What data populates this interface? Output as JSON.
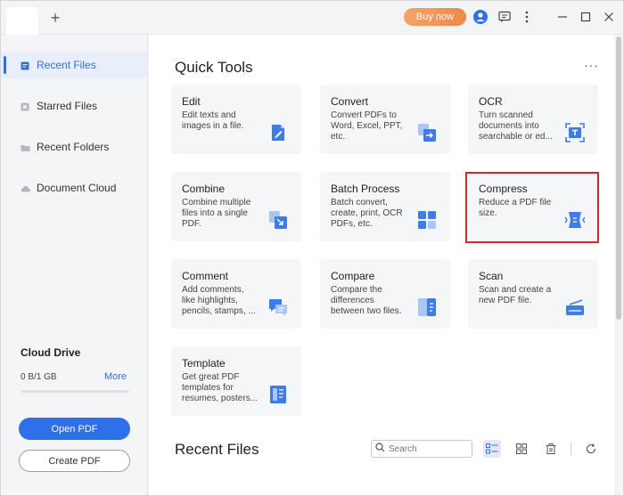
{
  "titlebar": {
    "add_tab_label": "+",
    "buy_now_label": "Buy now",
    "icons": [
      "account-icon",
      "message-icon",
      "more-vertical-icon",
      "minimize-icon",
      "maximize-icon",
      "close-icon"
    ]
  },
  "sidebar": {
    "items": [
      {
        "label": "Recent Files",
        "icon": "recent-files-icon",
        "active": true
      },
      {
        "label": "Starred Files",
        "icon": "star-icon",
        "active": false
      },
      {
        "label": "Recent Folders",
        "icon": "folder-icon",
        "active": false
      },
      {
        "label": "Document Cloud",
        "icon": "cloud-icon",
        "active": false
      }
    ],
    "cloud_drive": {
      "title": "Cloud Drive",
      "storage": "0 B/1 GB",
      "more_label": "More",
      "usage_fraction": 0
    },
    "open_pdf_label": "Open PDF",
    "create_pdf_label": "Create PDF"
  },
  "main": {
    "quick_tools_title": "Quick Tools",
    "more_label": "···",
    "tools": [
      {
        "title": "Edit",
        "desc": "Edit texts and\nimages in a file.",
        "icon": "edit-icon"
      },
      {
        "title": "Convert",
        "desc": "Convert PDFs to\nWord, Excel, PPT,\netc.",
        "icon": "convert-icon"
      },
      {
        "title": "OCR",
        "desc": "Turn scanned\ndocuments into\nsearchable or ed...",
        "icon": "ocr-icon"
      },
      {
        "title": "Combine",
        "desc": "Combine multiple\nfiles into a single\nPDF.",
        "icon": "combine-icon"
      },
      {
        "title": "Batch Process",
        "desc": "Batch convert,\ncreate, print, OCR\nPDFs, etc.",
        "icon": "batch-process-icon"
      },
      {
        "title": "Compress",
        "desc": "Reduce a PDF file\nsize.",
        "icon": "compress-icon"
      },
      {
        "title": "Comment",
        "desc": "Add comments,\nlike highlights,\npencils, stamps, ...",
        "icon": "comment-icon"
      },
      {
        "title": "Compare",
        "desc": "Compare the\ndifferences\nbetween two files.",
        "icon": "compare-icon"
      },
      {
        "title": "Scan",
        "desc": "Scan and create a\nnew PDF file.",
        "icon": "scan-icon"
      },
      {
        "title": "Template",
        "desc": "Get great PDF\ntemplates for\nresumes, posters...",
        "icon": "template-icon"
      }
    ],
    "recent_files_title": "Recent Files",
    "search": {
      "placeholder": "Search",
      "value": ""
    },
    "view_icons": [
      "list-view-icon",
      "grid-view-icon",
      "trash-icon",
      "refresh-icon"
    ]
  },
  "colors": {
    "accent": "#2f6fea",
    "buy_now": "#f0874b",
    "highlight_border": "#e0242a"
  }
}
